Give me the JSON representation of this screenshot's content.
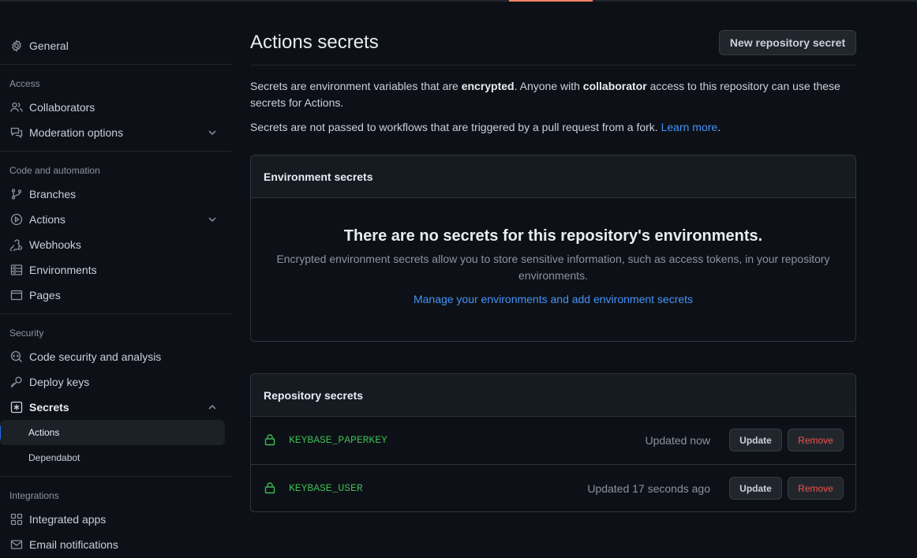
{
  "sidebar": {
    "general": "General",
    "sections": {
      "access": "Access",
      "code_automation": "Code and automation",
      "security": "Security",
      "integrations": "Integrations"
    },
    "items": {
      "collaborators": "Collaborators",
      "moderation": "Moderation options",
      "branches": "Branches",
      "actions": "Actions",
      "webhooks": "Webhooks",
      "environments": "Environments",
      "pages": "Pages",
      "code_security": "Code security and analysis",
      "deploy_keys": "Deploy keys",
      "secrets": "Secrets",
      "secrets_actions": "Actions",
      "secrets_dependabot": "Dependabot",
      "integrated_apps": "Integrated apps",
      "email_notifications": "Email notifications"
    }
  },
  "main": {
    "title": "Actions secrets",
    "new_secret_button": "New repository secret",
    "desc1_a": "Secrets are environment variables that are ",
    "desc1_b": "encrypted",
    "desc1_c": ". Anyone with ",
    "desc1_d": "collaborator",
    "desc1_e": " access to this repository can use these secrets for Actions.",
    "desc2": "Secrets are not passed to workflows that are triggered by a pull request from a fork. ",
    "learn_more": "Learn more",
    "desc2_end": ".",
    "env_secrets": {
      "header": "Environment secrets",
      "empty_title": "There are no secrets for this repository's environments.",
      "empty_desc": "Encrypted environment secrets allow you to store sensitive information, such as access tokens, in your repository environments.",
      "manage_link": "Manage your environments and add environment secrets"
    },
    "repo_secrets": {
      "header": "Repository secrets",
      "update_label": "Update",
      "remove_label": "Remove",
      "rows": [
        {
          "name": "KEYBASE_PAPERKEY",
          "updated": "Updated now"
        },
        {
          "name": "KEYBASE_USER",
          "updated": "Updated 17 seconds ago"
        }
      ]
    }
  },
  "colors": {
    "accent_tab": "#f78166",
    "link": "#4493f8",
    "secret_green": "#3fb950",
    "danger": "#f85149"
  }
}
